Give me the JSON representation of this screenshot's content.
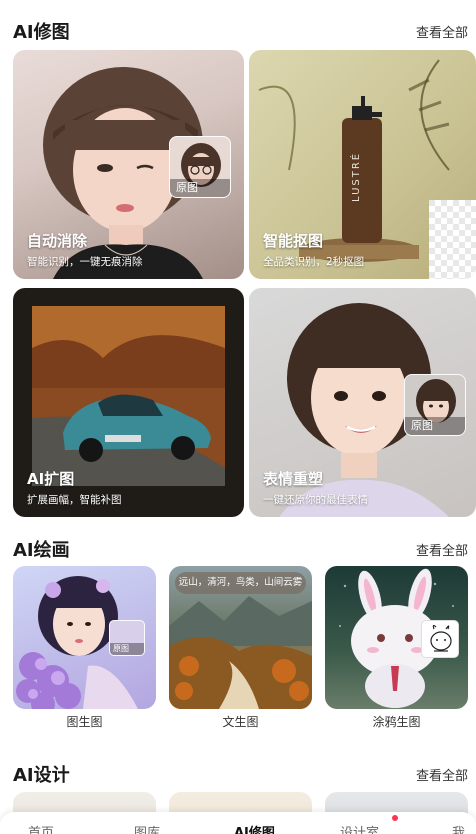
{
  "retouch": {
    "title": "AI修图",
    "see_all": "查看全部",
    "cards": [
      {
        "title": "自动消除",
        "subtitle": "智能识别，一键无痕消除",
        "badge": "原图"
      },
      {
        "title": "智能抠图",
        "subtitle": "全品类识别，2秒抠图",
        "product_text": "LUSTRÉ"
      },
      {
        "title": "AI扩图",
        "subtitle": "扩展画幅，智能补图"
      },
      {
        "title": "表情重塑",
        "subtitle": "一键还原你的最佳表情",
        "badge": "原图"
      }
    ]
  },
  "drawing": {
    "title": "AI绘画",
    "see_all": "查看全部",
    "items": [
      {
        "label": "图生图",
        "badge": "原图"
      },
      {
        "label": "文生图",
        "prompt": "远山，清河，鸟类，山间云雾"
      },
      {
        "label": "涂鸦生图"
      }
    ]
  },
  "design": {
    "title": "AI设计",
    "see_all": "查看全部"
  },
  "tabbar": {
    "items": [
      "首页",
      "图库",
      "AI修图",
      "设计室",
      "我的"
    ],
    "active_index": 2
  }
}
